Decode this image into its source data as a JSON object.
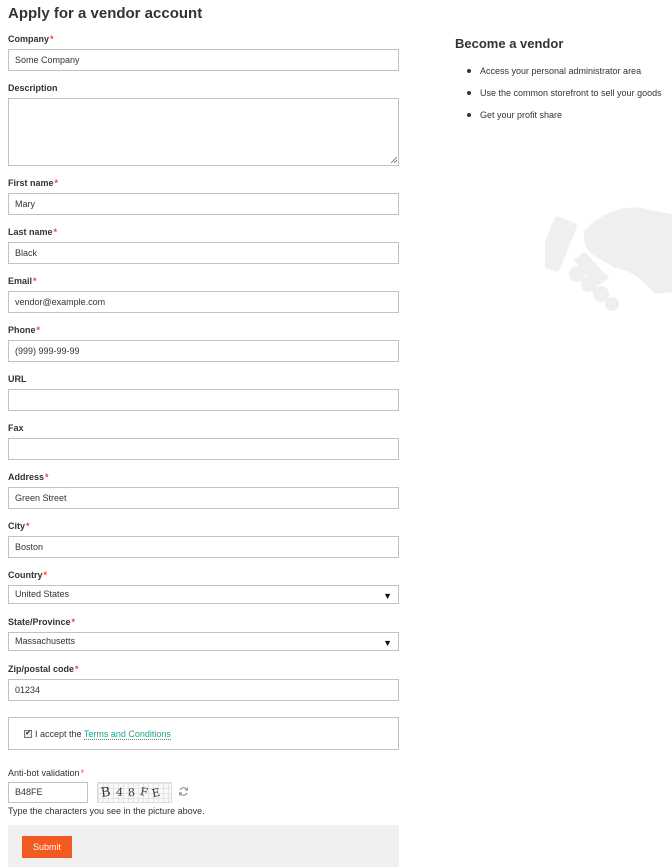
{
  "page": {
    "title": "Apply for a vendor account"
  },
  "form": {
    "company": {
      "label": "Company",
      "value": "Some Company",
      "required": true
    },
    "description": {
      "label": "Description",
      "value": "",
      "required": false
    },
    "first_name": {
      "label": "First name",
      "value": "Mary",
      "required": true
    },
    "last_name": {
      "label": "Last name",
      "value": "Black",
      "required": true
    },
    "email": {
      "label": "Email",
      "value": "vendor@example.com",
      "required": true
    },
    "phone": {
      "label": "Phone",
      "value": "(999) 999-99-99",
      "required": true
    },
    "url": {
      "label": "URL",
      "value": "",
      "required": false
    },
    "fax": {
      "label": "Fax",
      "value": "",
      "required": false
    },
    "address": {
      "label": "Address",
      "value": "Green Street",
      "required": true
    },
    "city": {
      "label": "City",
      "value": "Boston",
      "required": true
    },
    "country": {
      "label": "Country",
      "value": "United States",
      "required": true
    },
    "state": {
      "label": "State/Province",
      "value": "Massachusetts",
      "required": true
    },
    "zip": {
      "label": "Zip/postal code",
      "value": "01234",
      "required": true
    },
    "required_mark": "*"
  },
  "accept": {
    "checked": true,
    "check_mark": "✔",
    "text": "I accept the",
    "link": "Terms and Conditions"
  },
  "antibot": {
    "label": "Anti-bot validation",
    "value": "B48FE",
    "captcha_chars": [
      "B",
      "4",
      "8",
      "F",
      "E"
    ],
    "hint": "Type the characters you see in the picture above."
  },
  "submit": {
    "label": "Submit"
  },
  "sidebar": {
    "title": "Become a vendor",
    "items": [
      "Access your personal administrator area",
      "Use the common storefront to sell your goods",
      "Get your profit share"
    ]
  },
  "icons": {
    "select_arrow": "▼",
    "refresh": "refresh-icon",
    "handshake": "handshake-icon"
  },
  "colors": {
    "accent": "#f15a22",
    "link": "#2a9c8a",
    "required": "#e8453c"
  }
}
